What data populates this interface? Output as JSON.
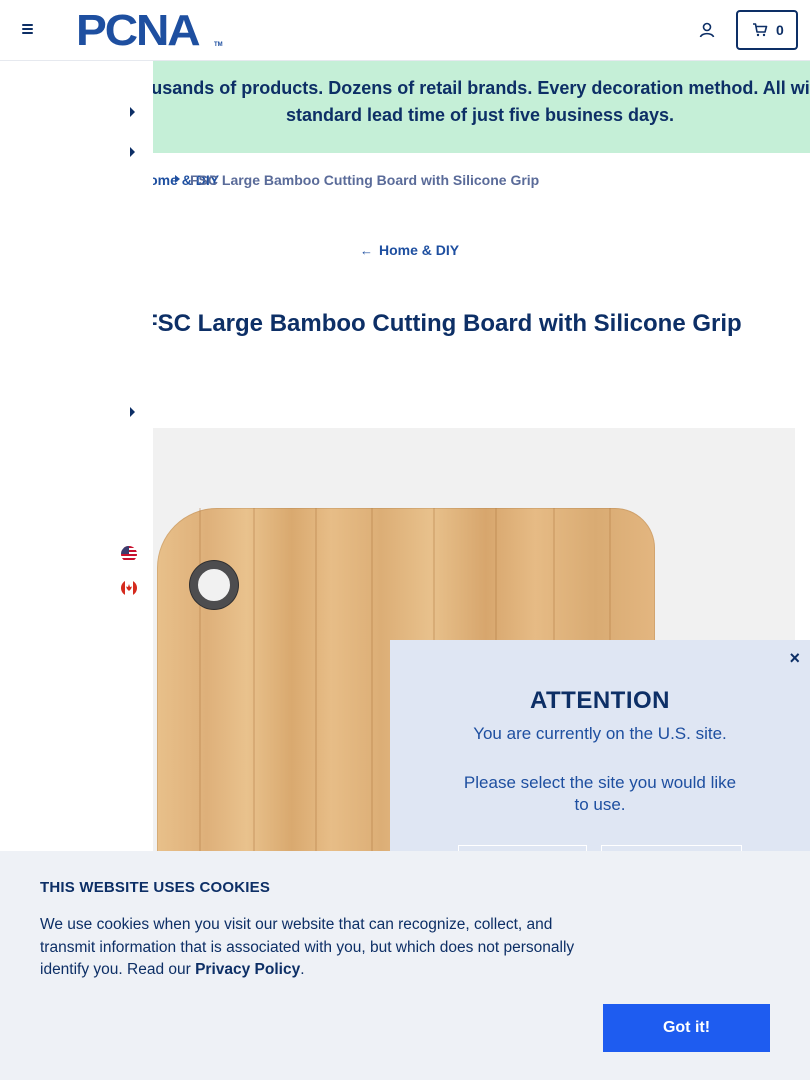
{
  "header": {
    "logo_text": "PCNA",
    "logo_tm": "TM",
    "cart_count": "0",
    "icons": {
      "menu": "hamburger-icon",
      "account": "user-icon",
      "cart": "cart-icon"
    }
  },
  "banner": {
    "text": "Thousands of products. Dozens of retail brands. Every decoration method. All with a standard lead time of just five business days."
  },
  "breadcrumb": {
    "previous": "Home & DIY",
    "current": "FSC Large Bamboo Cutting Board with Silicone Grip"
  },
  "back_link": {
    "label": "Home & DIY"
  },
  "product": {
    "title": "FSC Large Bamboo Cutting Board with Silicone Grip"
  },
  "site_switcher": {
    "flags": [
      "us-flag-icon",
      "canada-flag-icon"
    ]
  },
  "attention": {
    "title": "ATTENTION",
    "line": "You are currently on the U.S. site.",
    "prompt": "Please select the site you would like to use.",
    "close": "×"
  },
  "cookie": {
    "title": "THIS WEBSITE USES COOKIES",
    "text_before": "We use cookies when you visit our website that can recognize, collect, and transmit information that is associated with you, but which does not personally identify you. Read our ",
    "link": "Privacy Policy",
    "text_after": ".",
    "button": "Got it!"
  },
  "colors": {
    "navy": "#0d2f66",
    "brand_blue": "#1e4fa0",
    "banner_bg": "#c5efd7",
    "cookie_button": "#1e5cf0",
    "popup_bg": "#dfe6f3"
  }
}
